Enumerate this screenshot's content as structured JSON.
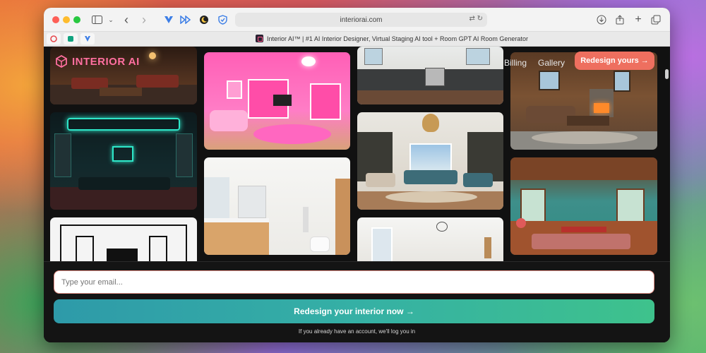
{
  "browser": {
    "url": "interiorai.com",
    "tab_title": "Interior AI™ | #1 AI Interior Designer, Virtual Staging AI tool + Room GPT AI Room Generator",
    "icons": [
      "sidebar-icon",
      "back-icon",
      "forward-icon",
      "extension-icon",
      "share-icon",
      "new-tab-icon",
      "tabs-overview-icon",
      "download-icon"
    ]
  },
  "nav": {
    "brand": "INTERIOR AI",
    "links": [
      "Billing",
      "Gallery"
    ],
    "cta": "Redesign yours →"
  },
  "signup": {
    "email_placeholder": "Type your email...",
    "cta": "Redesign your interior now →",
    "note": "If you already have an account, we'll log you in"
  },
  "colors": {
    "brand_pink": "#ff6fa0",
    "cta_coral": "#ee6f5f",
    "cta_gradient_start": "#2e9aa9",
    "cta_gradient_end": "#3ec28c"
  }
}
